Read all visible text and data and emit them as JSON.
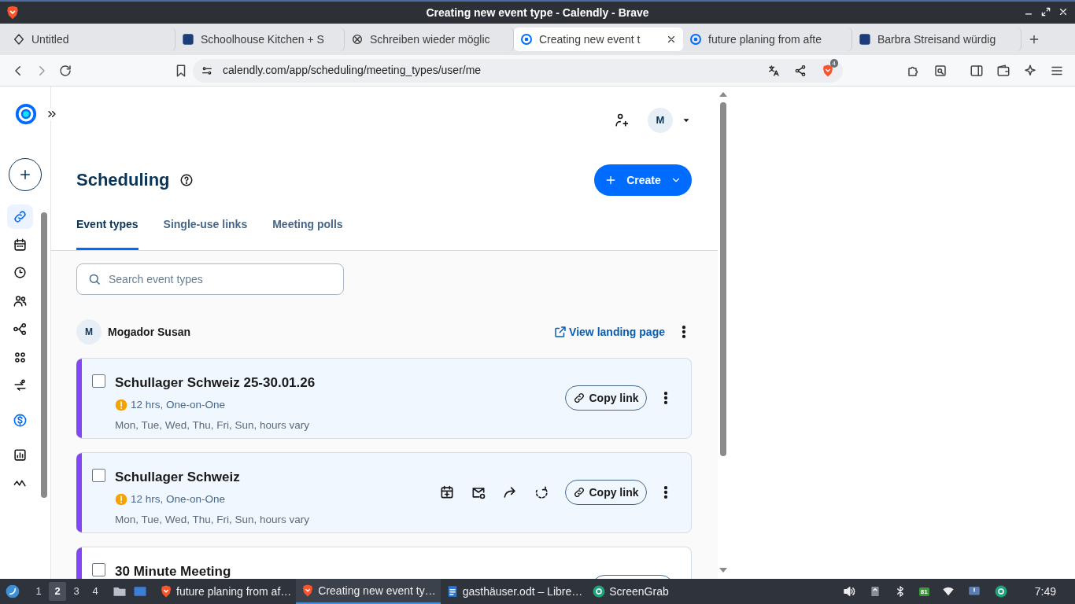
{
  "window": {
    "title": "Creating new event type - Calendly - Brave"
  },
  "browser_tabs": [
    {
      "label": "Untitled",
      "selected": false,
      "kind": "generic"
    },
    {
      "label": "Schoolhouse Kitchen + S",
      "selected": false,
      "kind": "square"
    },
    {
      "label": "Schreiben wieder möglic",
      "selected": false,
      "kind": "knot"
    },
    {
      "label": "Creating new event t",
      "selected": true,
      "kind": "calendly"
    },
    {
      "label": "future planing from afte",
      "selected": false,
      "kind": "calendly"
    },
    {
      "label": "Barbra Streisand würdig",
      "selected": false,
      "kind": "square"
    }
  ],
  "address_bar": {
    "url": "calendly.com/app/scheduling/meeting_types/user/me",
    "shields_count": "4"
  },
  "nav_items": [
    {
      "kind": "link",
      "selected": true
    },
    {
      "kind": "calendar",
      "selected": false
    },
    {
      "kind": "clock",
      "selected": false
    },
    {
      "kind": "people",
      "selected": false
    },
    {
      "kind": "workflow",
      "selected": false
    },
    {
      "kind": "apps",
      "selected": false
    },
    {
      "kind": "routing",
      "selected": false
    },
    {
      "kind": "dollar",
      "selected": false
    },
    {
      "kind": "chart",
      "selected": false
    },
    {
      "kind": "activity",
      "selected": false
    }
  ],
  "header": {
    "avatar_initial": "M"
  },
  "page": {
    "title": "Scheduling",
    "create_label": "Create"
  },
  "tabs": [
    {
      "label": "Event types",
      "selected": true
    },
    {
      "label": "Single-use links",
      "selected": false
    },
    {
      "label": "Meeting polls",
      "selected": false
    }
  ],
  "search": {
    "placeholder": "Search event types"
  },
  "owner": {
    "initial": "M",
    "name": "Mogador Susan",
    "link": "View landing page"
  },
  "event_types": [
    {
      "title": "Schullager Schweiz 25-30.01.26",
      "warning": true,
      "details": "12 hrs, One-on-One",
      "schedule": "Mon, Tue, Wed, Thu, Fri, Sun, hours vary",
      "copy_label": "Copy link",
      "color": "#8247f5",
      "highlighted": true,
      "show_actions": false
    },
    {
      "title": "Schullager Schweiz",
      "warning": true,
      "details": "12 hrs, One-on-One",
      "schedule": "Mon, Tue, Wed, Thu, Fri, Sun, hours vary",
      "copy_label": "Copy link",
      "color": "#8247f5",
      "highlighted": true,
      "show_actions": true
    },
    {
      "title": "30 Minute Meeting",
      "warning": false,
      "color": "#8247f5",
      "highlighted": false,
      "show_actions": false
    }
  ],
  "taskbar": {
    "workspaces": [
      {
        "label": "1",
        "selected": false
      },
      {
        "label": "2",
        "selected": true
      },
      {
        "label": "3",
        "selected": false
      },
      {
        "label": "4",
        "selected": false
      }
    ],
    "apps": [
      {
        "label": "future planing from af…",
        "selected": false,
        "kind": "brave"
      },
      {
        "label": "Creating new event ty…",
        "selected": true,
        "kind": "brave"
      },
      {
        "label": "gasthäuser.odt – Libre…",
        "selected": false,
        "kind": "doc"
      },
      {
        "label": "ScreenGrab",
        "selected": false,
        "kind": "grab"
      }
    ],
    "battery": "81",
    "clock": "7:49"
  }
}
